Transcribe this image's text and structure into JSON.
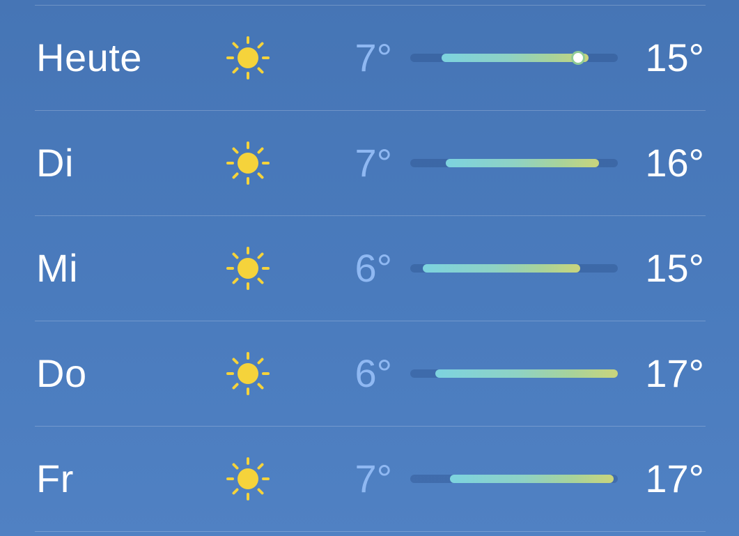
{
  "forecast": {
    "accent_colors": {
      "sun": "#f5d33b",
      "low_text": "#8fb8f2",
      "bar_start": "#7dd3df",
      "bar_end": "#c9d47c"
    },
    "days": [
      {
        "label": "Heute",
        "icon": "sun-icon",
        "low": "7°",
        "high": "15°",
        "bar_start": 0.15,
        "bar_end": 0.86,
        "current_marker": 0.81
      },
      {
        "label": "Di",
        "icon": "sun-icon",
        "low": "7°",
        "high": "16°",
        "bar_start": 0.17,
        "bar_end": 0.91
      },
      {
        "label": "Mi",
        "icon": "sun-icon",
        "low": "6°",
        "high": "15°",
        "bar_start": 0.06,
        "bar_end": 0.82
      },
      {
        "label": "Do",
        "icon": "sun-icon",
        "low": "6°",
        "high": "17°",
        "bar_start": 0.12,
        "bar_end": 1.0
      },
      {
        "label": "Fr",
        "icon": "sun-icon",
        "low": "7°",
        "high": "17°",
        "bar_start": 0.19,
        "bar_end": 0.98
      }
    ]
  }
}
